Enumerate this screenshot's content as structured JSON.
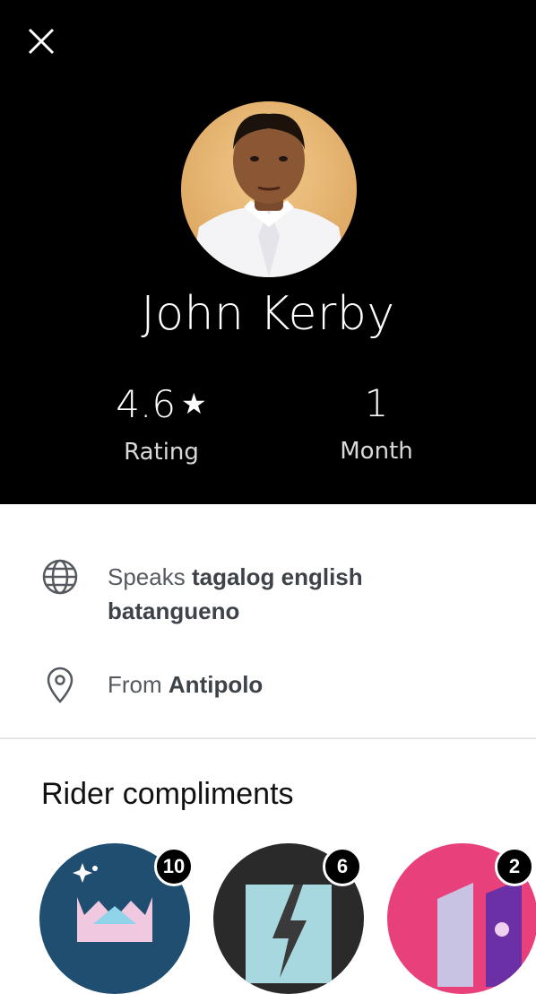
{
  "header": {
    "close_icon": "close-icon",
    "driver_name": "John Kerby",
    "rating_value": "4.6",
    "rating_star": "★",
    "rating_label": "Rating",
    "tenure_value": "1",
    "tenure_label": "Month"
  },
  "info": {
    "languages_prefix": "Speaks",
    "languages_line1": "tagalog english",
    "languages_line2": "batangueno",
    "location_prefix": "From",
    "location_value": "Antipolo"
  },
  "compliments": {
    "title": "Rider compliments",
    "items": [
      {
        "icon": "sparkle-crown-compliment-icon",
        "count": "10",
        "color": "#1f4e70"
      },
      {
        "icon": "lightning-compliment-icon",
        "count": "6",
        "color": "#2a2a2a"
      },
      {
        "icon": "music-compliment-icon",
        "count": "2",
        "color": "#e8407a"
      }
    ]
  },
  "colors": {
    "header_bg": "#000000",
    "text_muted": "#555a60"
  }
}
